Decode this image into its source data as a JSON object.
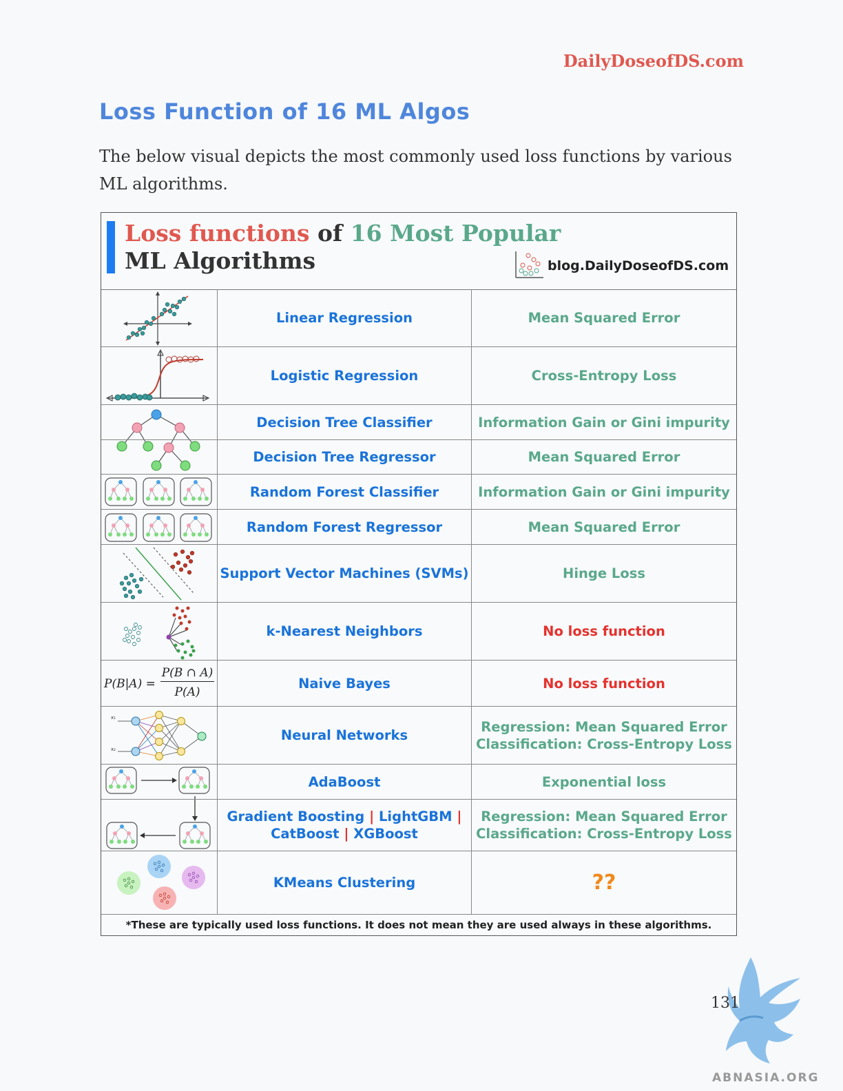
{
  "site": "DailyDoseofDS.com",
  "title": "Loss Function of 16 ML Algos",
  "intro": "The below visual depicts the most commonly used loss functions by various ML algorithms.",
  "card": {
    "heading_part1": "Loss functions",
    "heading_part2": " of ",
    "heading_part3": "16 Most Popular",
    "heading_line2": "ML Algorithms",
    "blog": "blog.DailyDoseofDS.com",
    "rows": [
      {
        "algo": "Linear Regression",
        "loss": "Mean Squared Error"
      },
      {
        "algo": "Logistic Regression",
        "loss": "Cross-Entropy Loss"
      },
      {
        "algo": "Decision Tree Classifier",
        "loss": "Information Gain or Gini impurity"
      },
      {
        "algo": "Decision Tree Regressor",
        "loss": "Mean Squared Error"
      },
      {
        "algo": "Random Forest Classifier",
        "loss": "Information Gain or Gini impurity"
      },
      {
        "algo": "Random Forest Regressor",
        "loss": "Mean Squared Error"
      },
      {
        "algo": "Support Vector Machines (SVMs)",
        "loss": "Hinge Loss"
      },
      {
        "algo": "k-Nearest Neighbors",
        "loss": "No loss function"
      },
      {
        "algo": "Naive Bayes",
        "loss": "No loss function"
      },
      {
        "algo": "Neural Networks",
        "loss_line1": "Regression: Mean Squared Error",
        "loss_line2": "Classification: Cross-Entropy Loss"
      },
      {
        "algo": "AdaBoost",
        "loss": "Exponential loss"
      },
      {
        "algo_a": "Gradient Boosting",
        "algo_b": "LightGBM",
        "algo_c": "CatBoost",
        "algo_d": "XGBoost",
        "sep": "|",
        "loss_line1": "Regression: Mean Squared Error",
        "loss_line2": "Classification: Cross-Entropy Loss"
      },
      {
        "algo": "KMeans Clustering",
        "loss": "??"
      }
    ],
    "bayes_formula": {
      "lhs": "P(B|A) =",
      "num": "P(B ∩ A)",
      "den": "P(A)"
    },
    "nn_inputs": [
      "x₁",
      "x₂"
    ],
    "footnote": "*These are typically used loss functions. It does not mean they are used always in these algorithms."
  },
  "page_number": "131",
  "watermark": "ABNASIA.ORG",
  "colors": {
    "accent": "#4f86dc",
    "red": "#e0584f",
    "green": "#5aa88a",
    "blue": "#1a73d9",
    "alert": "#e5322d",
    "orange": "#f08a1c"
  }
}
